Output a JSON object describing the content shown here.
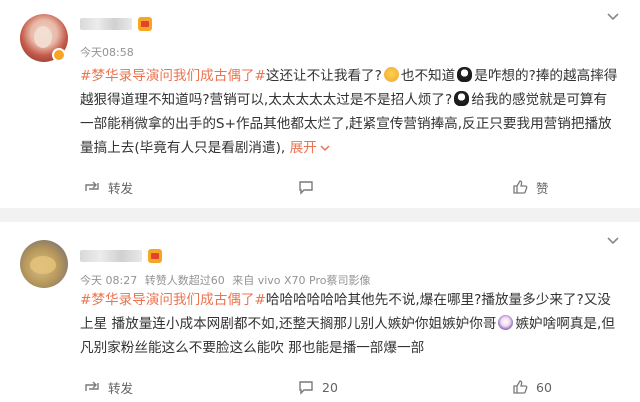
{
  "posts": [
    {
      "meta": {
        "time": "今天08:58",
        "extras": []
      },
      "content": {
        "topic": "#梦华录导演问我们成古偶了#",
        "text_a": "这还让不让我看了?",
        "text_b": "也不知道",
        "text_c": "是咋想的?捧的越高摔得越狠得道理不知道吗?营销可以,太太太太太过是不是招人烦了?",
        "text_d": "给我的感觉就是可算有一部能稍微拿的出手的S+作品其他都太烂了,赶紧宣传营销捧高,反正只要我用营销把播放量搞上去(毕竟有人只是看剧消遣),",
        "expand": "展开",
        "expand_icon": "chevron-down-icon"
      },
      "actions": {
        "repost": "转发",
        "comment": "",
        "like": "赞"
      }
    },
    {
      "meta": {
        "time": "今天 08:27",
        "extras": [
          "转赞人数超过60",
          "来自 vivo X70 Pro蔡司影像"
        ]
      },
      "content": {
        "topic": "#梦华录导演问我们成古偶了#",
        "text_a": "哈哈哈哈哈哈其他先不说,爆在哪里?播放量多少来了?又没上星 播放量连小成本网剧都不如,还整天搁那儿别人嫉妒你姐嫉妒你哥",
        "text_b": "嫉妒啥啊真是,但凡别家粉丝能这么不要脸这么能吹 那也能是播一部爆一部"
      },
      "actions": {
        "repost": "转发",
        "comment": "20",
        "like": "60"
      }
    }
  ],
  "colors": {
    "topic": "#eb7350",
    "meta": "#939393",
    "text": "#333333",
    "divider": "#f2f2f2"
  },
  "icons": {
    "more": "chevron-down-icon",
    "repost": "repost-icon",
    "comment": "comment-icon",
    "like": "thumbs-up-icon",
    "verified": "verified-badge-icon",
    "member": "member-crown-icon"
  }
}
